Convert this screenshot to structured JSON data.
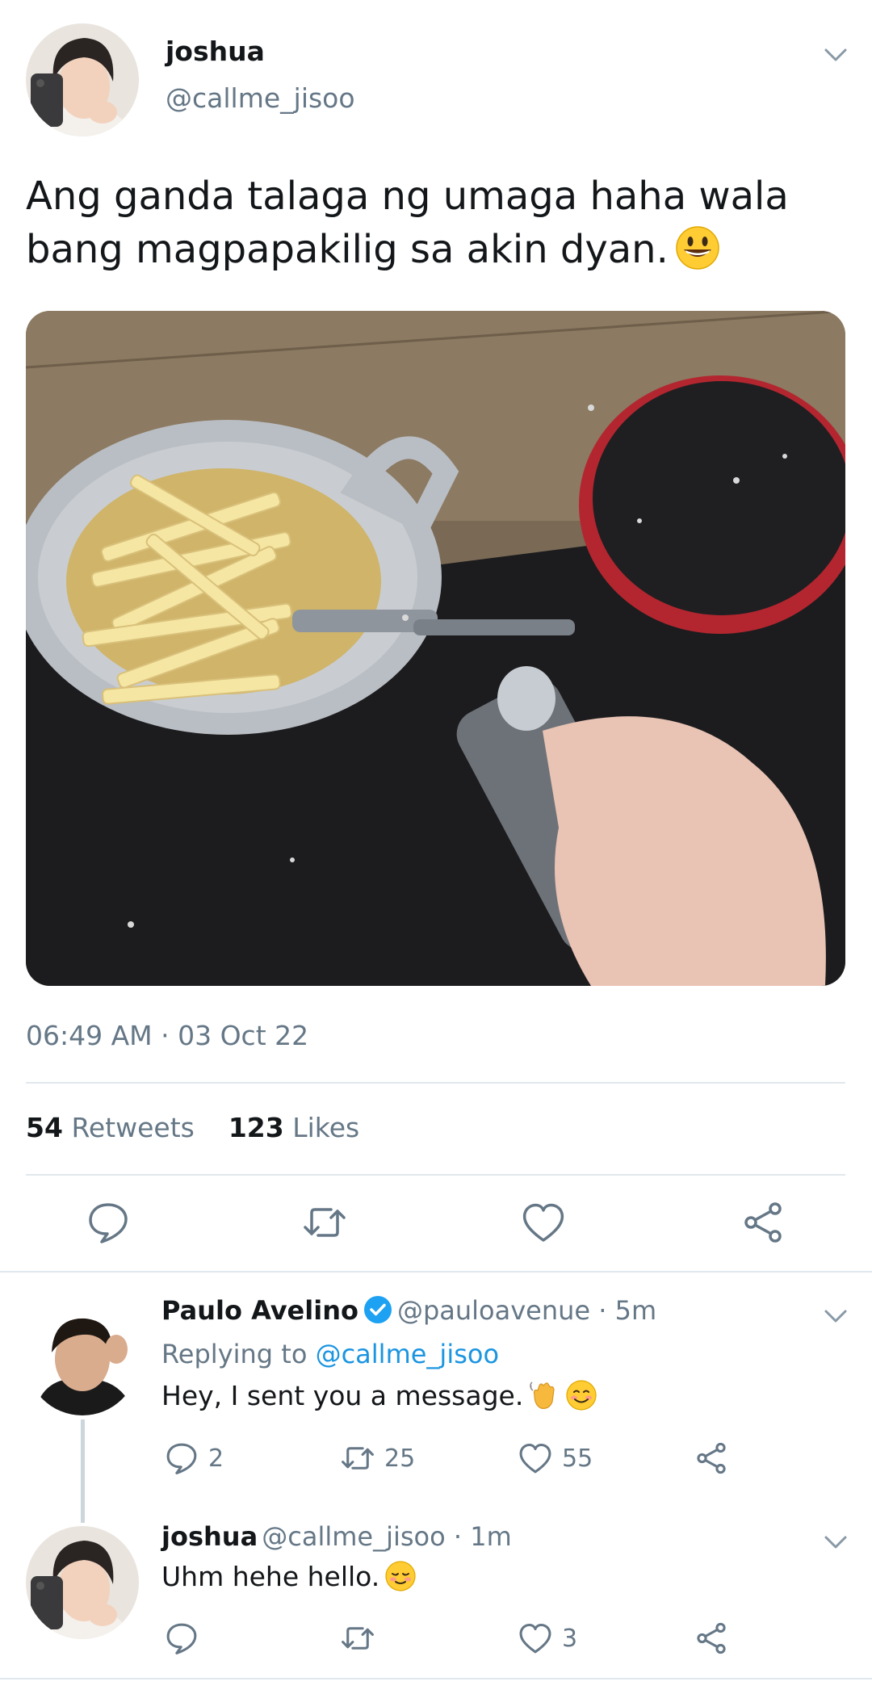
{
  "main_tweet": {
    "author_name": "joshua",
    "author_handle": "@callme_jisoo",
    "text": "Ang ganda talaga ng umaga haha wala bang magpapakilig sa akin dyan.",
    "emoji": "grinning-face-emoji",
    "timestamp": "06:49 AM · 03 Oct 22",
    "retweets_count": "54",
    "retweets_label": "Retweets",
    "likes_count": "123",
    "likes_label": "Likes",
    "actions": [
      "reply-icon",
      "retweet-icon",
      "heart-icon",
      "share-icon"
    ]
  },
  "replies": [
    {
      "name": "Paulo Avelino",
      "verified": true,
      "handle_time": "@pauloavenue · 5m",
      "replying_prefix": "Replying to",
      "replying_handle": "@callme_jisoo",
      "text": "Hey, I sent you a message.",
      "emojis": [
        "waving-hand-emoji",
        "smiling-face-emoji"
      ],
      "reply_count": "2",
      "retweet_count": "25",
      "like_count": "55"
    },
    {
      "name": "joshua",
      "handle_time": "@callme_jisoo · 1m",
      "text": "Uhm hehe hello.",
      "emojis": [
        "relieved-face-emoji"
      ],
      "like_count": "3"
    }
  ],
  "colors": {
    "text": "#14171a",
    "muted": "#657786",
    "link": "#1b95e0",
    "divider": "#e1e8ed",
    "verified": "#1da1f2"
  }
}
